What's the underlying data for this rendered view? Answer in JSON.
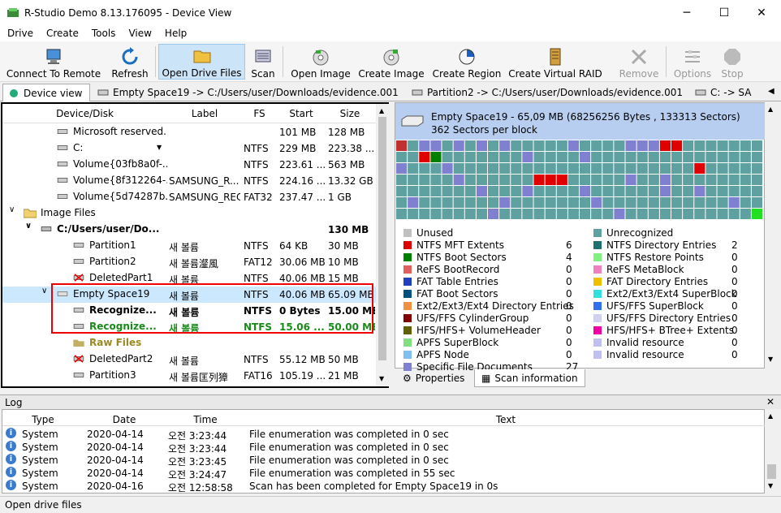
{
  "window": {
    "title": "R-Studio Demo 8.13.176095 - Device View",
    "minimize": "─",
    "maximize": "☐",
    "close": "✕"
  },
  "menu": [
    "Drive",
    "Create",
    "Tools",
    "View",
    "Help"
  ],
  "toolbar": {
    "connect": "Connect To Remote",
    "refresh": "Refresh",
    "open_drive_files": "Open Drive Files",
    "scan": "Scan",
    "open_image": "Open Image",
    "create_image": "Create Image",
    "create_region": "Create Region",
    "create_virtual_raid": "Create Virtual RAID",
    "remove": "Remove",
    "options": "Options",
    "stop": "Stop"
  },
  "tabs": [
    "Device view",
    "Empty Space19 -> C:/Users/user/Downloads/evidence.001",
    "Partition2 -> C:/Users/user/Downloads/evidence.001",
    "C: -> SA"
  ],
  "tree": {
    "columns": {
      "device": "Device/Disk",
      "label": "Label",
      "fs": "FS",
      "start": "Start",
      "size": "Size"
    },
    "rows": [
      {
        "name": "Microsoft reserved...",
        "label": "",
        "fs": "",
        "start": "101 MB",
        "size": "128 MB"
      },
      {
        "name": "C:",
        "label": "",
        "fs": "NTFS",
        "start": "229 MB",
        "size": "223.38 ..."
      },
      {
        "name": "Volume{03fb8a0f-...",
        "label": "",
        "fs": "NTFS",
        "start": "223.61 ...",
        "size": "563 MB"
      },
      {
        "name": "Volume{8f312264-...",
        "label": "SAMSUNG_R...",
        "fs": "NTFS",
        "start": "224.16 ...",
        "size": "13.32 GB"
      },
      {
        "name": "Volume{5d74287b...",
        "label": "SAMSUNG_REC",
        "fs": "FAT32",
        "start": "237.47 ...",
        "size": "1 GB"
      },
      {
        "name": "Image Files",
        "label": "",
        "fs": "",
        "start": "",
        "size": ""
      },
      {
        "name": "C:/Users/user/Do...",
        "label": "",
        "fs": "",
        "start": "",
        "size": "130 MB"
      },
      {
        "name": "Partition1",
        "label": "새 볼륨",
        "fs": "NTFS",
        "start": "64 KB",
        "size": "30 MB"
      },
      {
        "name": "Partition2",
        "label": "새 볼륨瀣風",
        "fs": "FAT12",
        "start": "30.06 MB",
        "size": "10 MB"
      },
      {
        "name": "DeletedPart1",
        "label": "새 볼륨",
        "fs": "NTFS",
        "start": "40.06 MB",
        "size": "15 MB"
      },
      {
        "name": "Empty Space19",
        "label": "새 볼륨",
        "fs": "NTFS",
        "start": "40.06 MB",
        "size": "65.09 MB"
      },
      {
        "name": "Recognize...",
        "label": "새 볼륨",
        "fs": "NTFS",
        "start": "0 Bytes",
        "size": "15.00 MB"
      },
      {
        "name": "Recognize...",
        "label": "새 볼륨",
        "fs": "NTFS",
        "start": "15.06 ...",
        "size": "50.00 MB"
      },
      {
        "name": "Raw Files",
        "label": "",
        "fs": "",
        "start": "",
        "size": ""
      },
      {
        "name": "DeletedPart2",
        "label": "새 볼륨",
        "fs": "NTFS",
        "start": "55.12 MB",
        "size": "50 MB"
      },
      {
        "name": "Partition3",
        "label": "새 볼륨匡列獐",
        "fs": "FAT16",
        "start": "105.19 ...",
        "size": "21 MB"
      }
    ]
  },
  "scan_panel": {
    "header": "Empty Space19 - 65,09 MB (68256256 Bytes , 133313 Sectors) 362 Sectors per block",
    "legend_left": [
      {
        "label": "Unused",
        "count": "",
        "color": "#c0c0c0"
      },
      {
        "label": "NTFS MFT Extents",
        "count": "6",
        "color": "#e00000"
      },
      {
        "label": "NTFS Boot Sectors",
        "count": "4",
        "color": "#008000"
      },
      {
        "label": "ReFS BootRecord",
        "count": "0",
        "color": "#e06060"
      },
      {
        "label": "FAT Table Entries",
        "count": "0",
        "color": "#2040c0"
      },
      {
        "label": "FAT Boot Sectors",
        "count": "0",
        "color": "#005080"
      },
      {
        "label": "Ext2/Ext3/Ext4 Directory Entries",
        "count": "0",
        "color": "#f09040"
      },
      {
        "label": "UFS/FFS CylinderGroup",
        "count": "0",
        "color": "#800000"
      },
      {
        "label": "HFS/HFS+ VolumeHeader",
        "count": "0",
        "color": "#606000"
      },
      {
        "label": "APFS SuperBlock",
        "count": "0",
        "color": "#80e080"
      },
      {
        "label": "APFS Node",
        "count": "0",
        "color": "#80c0f0"
      },
      {
        "label": "Specific File Documents",
        "count": "27",
        "color": "#8080d0"
      }
    ],
    "legend_right": [
      {
        "label": "Unrecognized",
        "count": "",
        "color": "#5fa0a0"
      },
      {
        "label": "NTFS Directory Entries",
        "count": "2",
        "color": "#207070"
      },
      {
        "label": "NTFS Restore Points",
        "count": "0",
        "color": "#80f080"
      },
      {
        "label": "ReFS MetaBlock",
        "count": "0",
        "color": "#f080c0"
      },
      {
        "label": "FAT Directory Entries",
        "count": "0",
        "color": "#f0c000"
      },
      {
        "label": "Ext2/Ext3/Ext4 SuperBlock",
        "count": "0",
        "color": "#30e0e0"
      },
      {
        "label": "UFS/FFS SuperBlock",
        "count": "0",
        "color": "#3070f0"
      },
      {
        "label": "UFS/FFS Directory Entries",
        "count": "0",
        "color": "#d0d0f0"
      },
      {
        "label": "HFS/HFS+ BTree+ Extents",
        "count": "0",
        "color": "#f000a0"
      },
      {
        "label": "Invalid resource",
        "count": "0",
        "color": "#c0c0f0"
      },
      {
        "label": "Invalid resource",
        "count": "0",
        "color": "#c0c0f0"
      }
    ],
    "tabs": {
      "properties": "Properties",
      "scan_info": "Scan information"
    }
  },
  "log": {
    "title": "Log",
    "columns": {
      "type": "Type",
      "date": "Date",
      "time": "Time",
      "text": "Text"
    },
    "rows": [
      {
        "type": "System",
        "date": "2020-04-14",
        "time": "오전 3:23:44",
        "text": "File enumeration was completed in 0 sec"
      },
      {
        "type": "System",
        "date": "2020-04-14",
        "time": "오전 3:23:44",
        "text": "File enumeration was completed in 0 sec"
      },
      {
        "type": "System",
        "date": "2020-04-14",
        "time": "오전 3:23:45",
        "text": "File enumeration was completed in 0 sec"
      },
      {
        "type": "System",
        "date": "2020-04-14",
        "time": "오전 3:24:47",
        "text": "File enumeration was completed in 55 sec"
      },
      {
        "type": "System",
        "date": "2020-04-16",
        "time": "오전 12:58:58",
        "text": "Scan has been completed for Empty Space19 in 0s"
      }
    ]
  },
  "status": "Open drive files"
}
